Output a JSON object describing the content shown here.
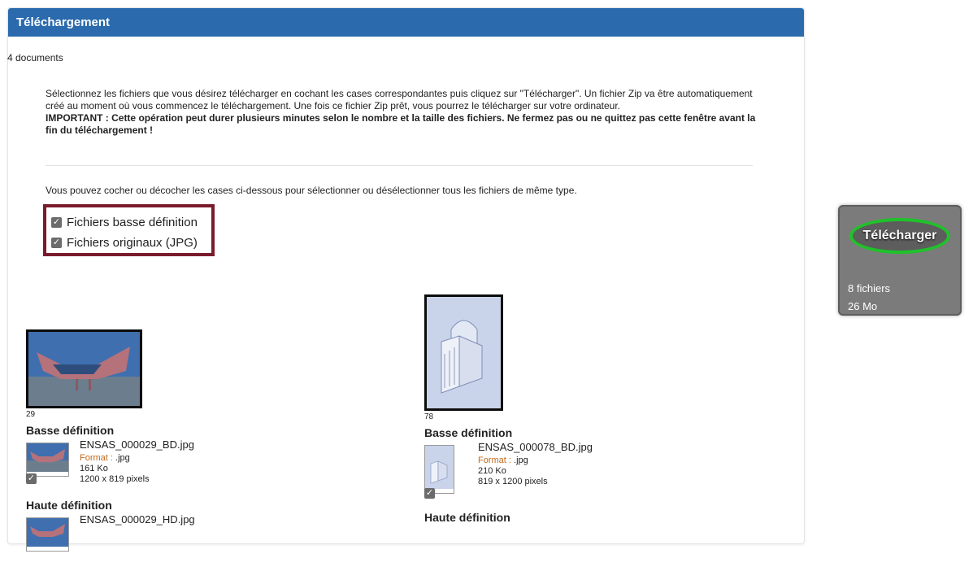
{
  "header": {
    "title": "Téléchargement"
  },
  "doc_count": "4 documents",
  "intro": {
    "text": "Sélectionnez les fichiers que vous désirez télécharger en cochant les cases correspondantes puis cliquez sur \"Télécharger\". Un fichier Zip va être automatiquement créé au moment où vous commencez le téléchargement. Une fois ce fichier Zip prêt, vous pourrez le télécharger sur votre ordinateur.",
    "important": "IMPORTANT : Cette opération peut durer plusieurs minutes selon le nombre et la taille des fichiers. Ne fermez pas ou ne quittez pas cette fenêtre avant la fin du téléchargement !"
  },
  "hint": "Vous pouvez cocher ou décocher les cases ci-dessous pour sélectionner ou désélectionner tous les fichiers de même type.",
  "type_toggles": [
    {
      "label": "Fichiers basse définition",
      "checked": true
    },
    {
      "label": "Fichiers originaux (JPG)",
      "checked": true
    }
  ],
  "items": [
    {
      "number": "29",
      "low_title": "Basse définition",
      "low": {
        "name": "ENSAS_000029_BD.jpg",
        "format_label": "Format :",
        "format": ".jpg",
        "size": "161 Ko",
        "dims": "1200 x 819 pixels"
      },
      "high_title": "Haute définition",
      "high": {
        "name": "ENSAS_000029_HD.jpg"
      }
    },
    {
      "number": "78",
      "low_title": "Basse définition",
      "low": {
        "name": "ENSAS_000078_BD.jpg",
        "format_label": "Format :",
        "format": ".jpg",
        "size": "210 Ko",
        "dims": "819 x 1200 pixels"
      },
      "high_title": "Haute définition"
    }
  ],
  "side": {
    "button_label": "Télécharger",
    "files": "8 fichiers",
    "size": "26 Mo"
  },
  "colors": {
    "header": "#2a6aad",
    "highlight_box": "#7a1b2c",
    "button_ring": "#1fc22a"
  }
}
